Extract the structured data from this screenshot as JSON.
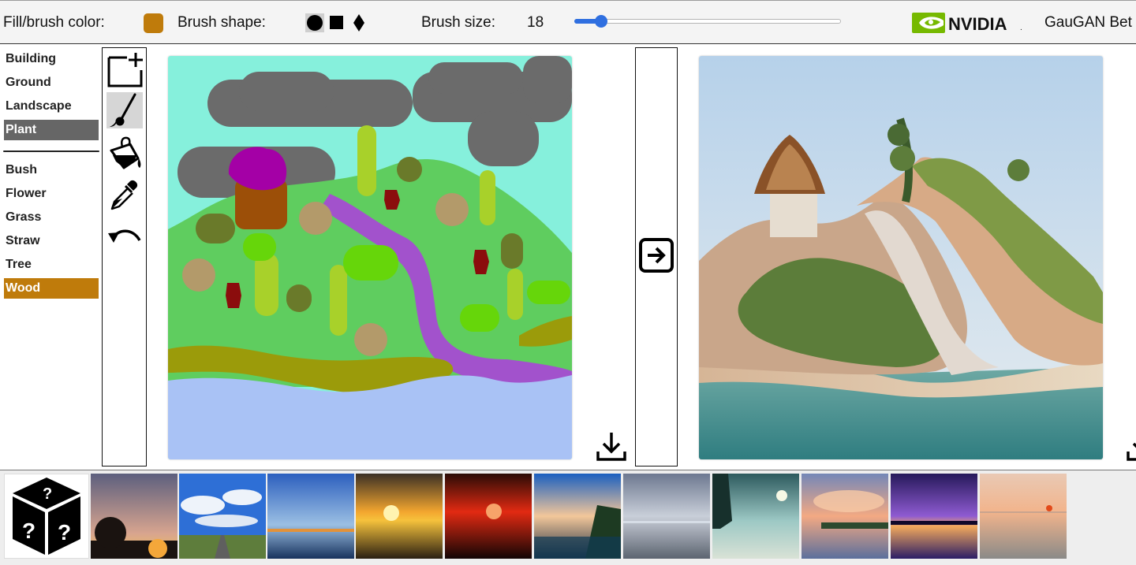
{
  "toolbar": {
    "fill_label": "Fill/brush color:",
    "fill_color": "#bf7b0b",
    "shape_label": "Brush shape:",
    "shapes": [
      "circle",
      "square",
      "diamond"
    ],
    "active_shape": "circle",
    "size_label": "Brush size:",
    "size_value": "18",
    "size_fraction": 0.1,
    "brand": "NVIDIA",
    "brand_suffix": ".",
    "app_title": "GauGAN Bet"
  },
  "labels": {
    "categories": [
      {
        "name": "Building",
        "selected": false
      },
      {
        "name": "Ground",
        "selected": false
      },
      {
        "name": "Landscape",
        "selected": false
      },
      {
        "name": "Plant",
        "selected": true
      }
    ],
    "items": [
      {
        "name": "Bush",
        "selected": false
      },
      {
        "name": "Flower",
        "selected": false
      },
      {
        "name": "Grass",
        "selected": false
      },
      {
        "name": "Straw",
        "selected": false
      },
      {
        "name": "Tree",
        "selected": false
      },
      {
        "name": "Wood",
        "selected": true
      }
    ],
    "category_selected_color": "#666666",
    "item_selected_color": "#bf7b0b"
  },
  "tools": [
    "new-canvas-icon",
    "brush-icon",
    "paint-bucket-icon",
    "eyedropper-icon",
    "undo-icon"
  ],
  "active_tool": "brush-icon",
  "segmentation_colors": {
    "sky": "#86f0dc",
    "cloud": "#6b6b6b",
    "hill": "#5fcd5f",
    "river": "#a252cc",
    "sand": "#9b9b0a",
    "water": "#a9c2f5",
    "house_roof": "#a400a6",
    "house_wall": "#9c4f08",
    "rock": "#b39a6a",
    "flower": "#8b0d0d",
    "bush": "#6a7a2a",
    "grass": "#a8d12a",
    "bright_grass": "#66d60a"
  },
  "style_thumbnails": [
    "sunset-silhouette-trees",
    "blue-sky-highway",
    "lake-blue-horizon",
    "golden-sunset-sea",
    "red-sunset",
    "coast-cliffs-sunset",
    "cloudy-beach",
    "night-beach-moon",
    "pink-clouds-lake",
    "purple-sunset-lake",
    "pastel-sunset-beach"
  ]
}
